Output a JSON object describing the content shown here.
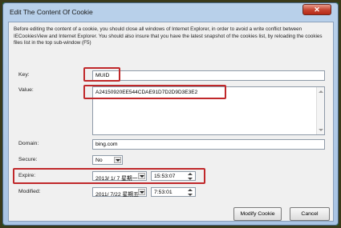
{
  "window": {
    "title": "Edit The Content Of Cookie",
    "close_label": "✕"
  },
  "description": "Before editing the content of a cookie, you should close all windows of Internet Explorer, in order to avoid a write conflict between IECookiesView and Internet Explorer. You should also insure that you have the latest snapshot of the cookies list, by reloading the cookies files list in the top sub-window (F5)",
  "form": {
    "key_label": "Key:",
    "key_value": "MUID",
    "value_label": "Value:",
    "value_value": "A24150920EE544CDAE91D7D2D9D3E3E2",
    "domain_label": "Domain:",
    "domain_value": "bing.com",
    "secure_label": "Secure:",
    "secure_value": "No",
    "expire_label": "Expire:",
    "expire_date": "2013/ 1/ 7 星期一",
    "expire_time": "15:53:07",
    "modified_label": "Modified:",
    "modified_date": "2011/ 7/22 星期五",
    "modified_time": "7:53:01"
  },
  "buttons": {
    "modify": "Modify Cookie",
    "cancel": "Cancel"
  },
  "colors": {
    "highlight": "#c0282a",
    "background": "#1c5c1e"
  }
}
